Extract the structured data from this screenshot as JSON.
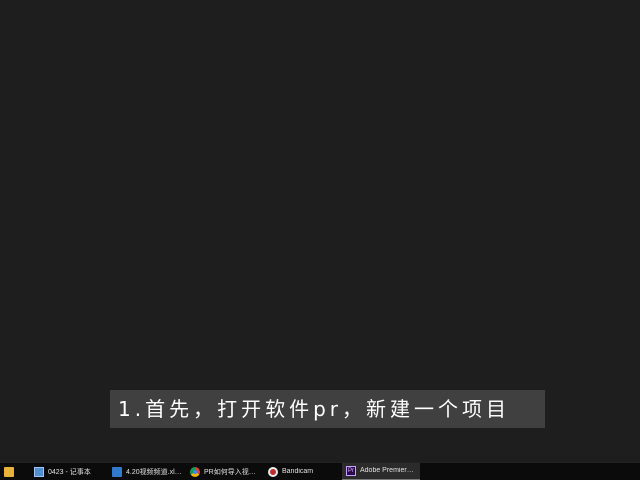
{
  "subtitle": {
    "text": "1.首先，打开软件pr，新建一个项目"
  },
  "taskbar": {
    "items": [
      {
        "label": "",
        "icon": "file-explorer-icon"
      },
      {
        "label": "0423 - 记事本",
        "icon": "notepad-icon"
      },
      {
        "label": "4.20视频频道.xlsx ...",
        "icon": "excel-icon"
      },
      {
        "label": "PR如何导入视频 - ...",
        "icon": "chrome-icon"
      },
      {
        "label": "Bandicam",
        "icon": "bandicam-icon"
      },
      {
        "label": "Adobe Premiere ...",
        "icon": "premiere-icon",
        "active": true
      }
    ],
    "premiere_icon_text": "Pr"
  },
  "colors": {
    "background": "#1e1e1e",
    "taskbar": "#0b0b0b",
    "subtitle_bg": "#464646",
    "subtitle_text": "#ffffff"
  }
}
